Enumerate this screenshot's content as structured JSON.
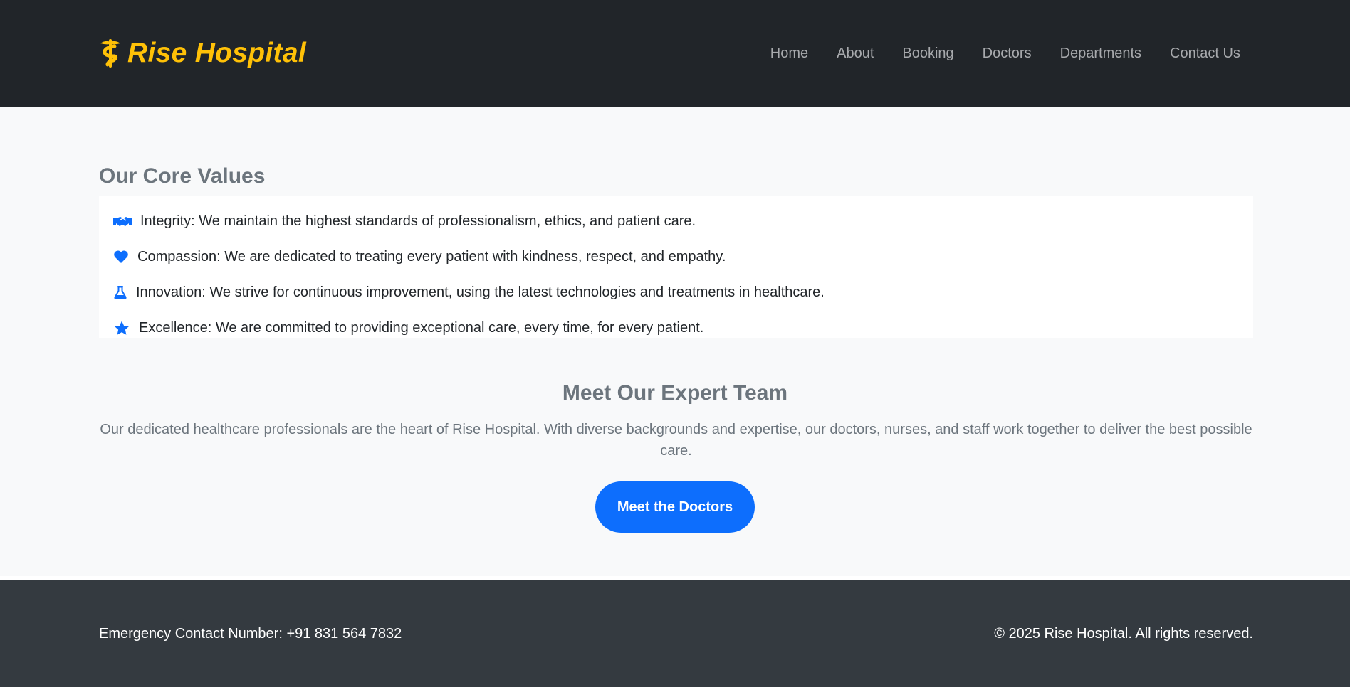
{
  "header": {
    "brand": {
      "icon": "caduceus-icon",
      "name": "Rise Hospital",
      "color": "#ffc107"
    },
    "nav": [
      {
        "label": "Home"
      },
      {
        "label": "About"
      },
      {
        "label": "Booking"
      },
      {
        "label": "Doctors"
      },
      {
        "label": "Departments"
      },
      {
        "label": "Contact Us"
      }
    ]
  },
  "core_values": {
    "title": "Our Core Values",
    "items": [
      {
        "icon": "handshake-icon",
        "text": "Integrity: We maintain the highest standards of professionalism, ethics, and patient care."
      },
      {
        "icon": "heart-icon",
        "text": "Compassion: We are dedicated to treating every patient with kindness, respect, and empathy."
      },
      {
        "icon": "flask-icon",
        "text": "Innovation: We strive for continuous improvement, using the latest technologies and treatments in healthcare."
      },
      {
        "icon": "star-icon",
        "text": "Excellence: We are committed to providing exceptional care, every time, for every patient."
      }
    ]
  },
  "team": {
    "title": "Meet Our Expert Team",
    "description": "Our dedicated healthcare professionals are the heart of Rise Hospital. With diverse backgrounds and expertise, our doctors, nurses, and staff work together to deliver the best possible care.",
    "button_label": "Meet the Doctors"
  },
  "footer": {
    "emergency": "Emergency Contact Number: +91 831 564 7832",
    "copyright": "© 2025 Rise Hospital. All rights reserved."
  },
  "colors": {
    "navbar_bg": "#212529",
    "accent": "#0d6efd",
    "brand": "#ffc107",
    "footer_bg": "#343a40"
  }
}
